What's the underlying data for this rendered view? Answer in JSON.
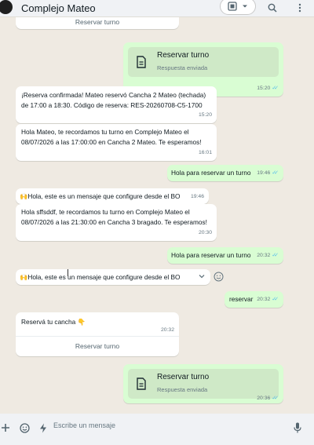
{
  "header": {
    "title": "Complejo Mateo"
  },
  "messages": {
    "top_card_button": "Reservar turno",
    "doc1": {
      "title": "Reservar turno",
      "subtitle": "Respuesta enviada",
      "time": "15:20"
    },
    "m1": {
      "text": "¡Reserva confirmada! Mateo reservó Cancha 2 Mateo (techada) de 17:00 a 18:30. Código de reserva: RES-20260708-C5-1700",
      "time": "15:20"
    },
    "m2": {
      "text": "Hola Mateo, te recordamos tu turno en Complejo Mateo el 08/07/2026 a las 17:00:00 en Cancha 2 Mateo. Te esperamos!",
      "time": "16:01"
    },
    "m3": {
      "text": "Hola para reservar un turno",
      "time": "19:46"
    },
    "m4": {
      "text": "🙌Hola, este es un mensaje que configure desde el BO",
      "time": "19:46"
    },
    "m5": {
      "text": "Hola sffsddf, te recordamos tu turno en Complejo Mateo el 08/07/2026 a las 21:30:00 en Cancha 3 bragado. Te esperamos!",
      "time": "20:30"
    },
    "m6": {
      "text": "Hola para reservar un turno",
      "time": "20:32"
    },
    "m7": {
      "text": "🙌Hola, este es un mensaje que configure desde el BO",
      "time": "20:32"
    },
    "m8": {
      "text": "reservar",
      "time": "20:32"
    },
    "m9": {
      "text": "Reservá tu cancha 👇",
      "time": "20:32",
      "button": "Reservar turno"
    },
    "doc2": {
      "title": "Reservar turno",
      "subtitle": "Respuesta enviada",
      "time": "20:36"
    }
  },
  "composer": {
    "placeholder": "Escribe un mensaje"
  },
  "colors": {
    "incoming": "#ffffff",
    "outgoing": "#d9fdd3",
    "background": "#efeae2",
    "read_ticks": "#53bdeb"
  }
}
